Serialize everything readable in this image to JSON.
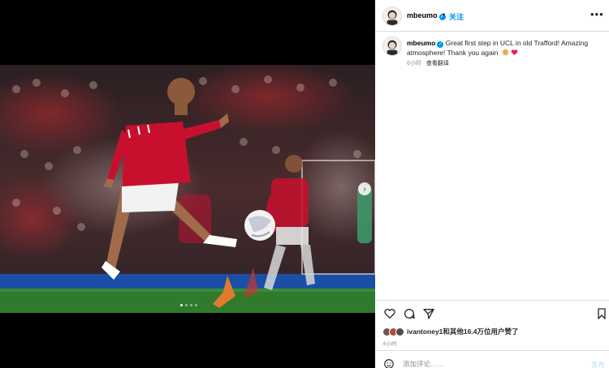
{
  "post": {
    "username": "mbeumo",
    "follow_dot": "•",
    "follow_label": "关注",
    "caption_text": "Great first step in UCL in old Trafford! Amazing atmosphere! Thank you again",
    "time_ago": "6小时",
    "translate_label": "查看翻译",
    "likes_user": "ivantoney1",
    "likes_rest": "和其他16.4万位用户赞了",
    "time_ago_2": "6小时",
    "comment_placeholder": "添加评论……",
    "post_label": "发布"
  },
  "carousel": {
    "current_slide": 1,
    "total_slides": 4
  },
  "icons": [
    "more-icon",
    "verified-icon",
    "heart-icon",
    "comment-icon",
    "share-icon",
    "bookmark-icon",
    "smile-icon",
    "chevron-right-icon"
  ],
  "colors": {
    "accent": "#0095f6",
    "muted": "#8e8e8e",
    "heart": "#e0245e",
    "kit_red": "#c8102e"
  }
}
